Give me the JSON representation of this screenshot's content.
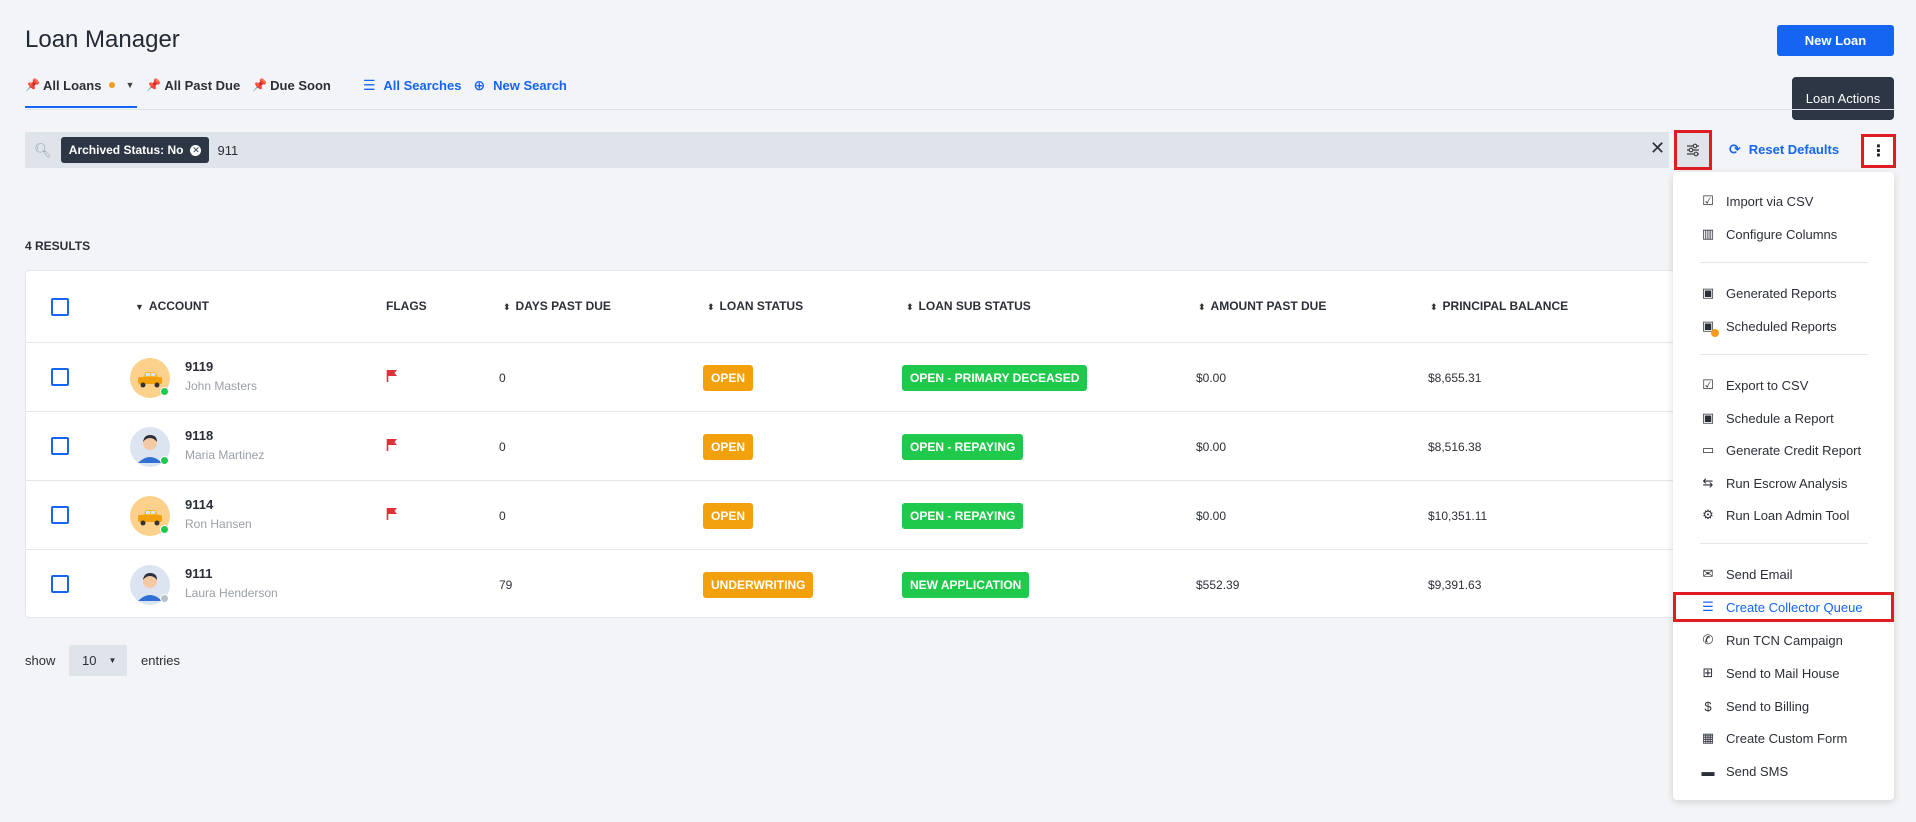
{
  "header": {
    "title": "Loan Manager",
    "new_loan_label": "New Loan"
  },
  "tabs": [
    {
      "label": "All Loans",
      "active": true
    },
    {
      "label": "All Past Due"
    },
    {
      "label": "Due Soon"
    }
  ],
  "tab_links": {
    "all_searches": "All Searches",
    "new_search": "New Search"
  },
  "search": {
    "chip_label": "Archived Status: No",
    "value": "911",
    "reset_label": "Reset Defaults"
  },
  "tooltip": "Loan Actions",
  "results_label": "4 RESULTS",
  "table": {
    "columns": [
      "ACCOUNT",
      "FLAGS",
      "DAYS PAST DUE",
      "LOAN STATUS",
      "LOAN SUB STATUS",
      "AMOUNT PAST DUE",
      "PRINCIPAL BALANCE"
    ],
    "rows": [
      {
        "account": "9119",
        "name": "John Masters",
        "flag": true,
        "days": "0",
        "status": "OPEN",
        "status_color": "#f2a10c",
        "sub_status": "OPEN - PRIMARY DECEASED",
        "amount_past_due": "$0.00",
        "principal": "$8,655.31",
        "avatar": "car",
        "online": true
      },
      {
        "account": "9118",
        "name": "Maria Martinez",
        "flag": true,
        "days": "0",
        "status": "OPEN",
        "status_color": "#f2a10c",
        "sub_status": "OPEN - REPAYING",
        "amount_past_due": "$0.00",
        "principal": "$8,516.38",
        "avatar": "person",
        "online": true
      },
      {
        "account": "9114",
        "name": "Ron Hansen",
        "flag": true,
        "days": "0",
        "status": "OPEN",
        "status_color": "#f2a10c",
        "sub_status": "OPEN - REPAYING",
        "amount_past_due": "$0.00",
        "principal": "$10,351.11",
        "avatar": "car",
        "online": true
      },
      {
        "account": "9111",
        "name": "Laura Henderson",
        "flag": false,
        "days": "79",
        "status": "UNDERWRITING",
        "status_color": "#f2a10c",
        "sub_status": "NEW APPLICATION",
        "amount_past_due": "$552.39",
        "principal": "$9,391.63",
        "avatar": "person",
        "online": false
      }
    ]
  },
  "pagination": {
    "show_label": "show",
    "page_size": "10",
    "entries_label": "entries"
  },
  "menu": {
    "items": [
      {
        "label": "Import via CSV",
        "icon": "edit-icon"
      },
      {
        "label": "Configure Columns",
        "icon": "columns-icon"
      },
      {
        "label": "Generated Reports",
        "icon": "report-icon"
      },
      {
        "label": "Scheduled Reports",
        "icon": "report-scheduled-icon"
      },
      {
        "label": "Export to CSV",
        "icon": "export-icon"
      },
      {
        "label": "Schedule a Report",
        "icon": "report-icon"
      },
      {
        "label": "Generate Credit Report",
        "icon": "credit-card-icon"
      },
      {
        "label": "Run Escrow Analysis",
        "icon": "swap-icon"
      },
      {
        "label": "Run Loan Admin Tool",
        "icon": "gear-icon"
      },
      {
        "label": "Send Email",
        "icon": "envelope-icon"
      },
      {
        "label": "Create Collector Queue",
        "icon": "list-icon"
      },
      {
        "label": "Run TCN Campaign",
        "icon": "phone-icon"
      },
      {
        "label": "Send to Mail House",
        "icon": "mailbox-icon"
      },
      {
        "label": "Send to Billing",
        "icon": "dollar-icon"
      },
      {
        "label": "Create Custom Form",
        "icon": "table-icon"
      },
      {
        "label": "Send SMS",
        "icon": "chat-icon"
      }
    ]
  }
}
